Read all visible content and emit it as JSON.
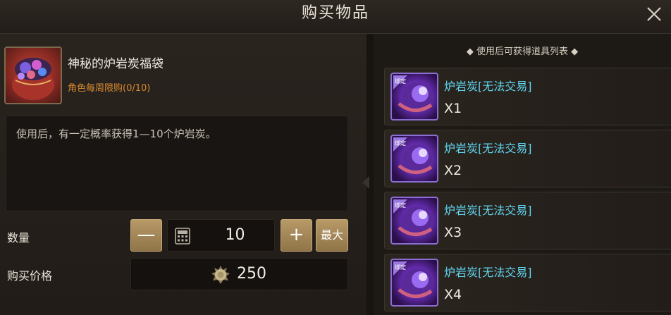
{
  "window": {
    "title": "购买物品"
  },
  "item": {
    "name": "神秘的炉岩炭福袋",
    "limit": "角色每周限购(0/10)",
    "icon": "lucky-bag-icon",
    "description": "使用后，有一定概率获得1—10个炉岩炭。"
  },
  "purchase": {
    "qty_label": "数量",
    "minus_label": "—",
    "plus_label": "+",
    "max_label": "最大",
    "quantity": "10",
    "price_label": "购买价格",
    "price": "250",
    "currency_icon": "gold-coin-icon"
  },
  "rewards": {
    "header": "◆ 使用后可获得道具列表 ◆",
    "items": [
      {
        "name": "炉岩炭[无法交易]",
        "qty": "X1",
        "badge": "绑定",
        "icon": "charcoal-orb-icon"
      },
      {
        "name": "炉岩炭[无法交易]",
        "qty": "X2",
        "badge": "绑定",
        "icon": "charcoal-orb-icon"
      },
      {
        "name": "炉岩炭[无法交易]",
        "qty": "X3",
        "badge": "绑定",
        "icon": "charcoal-orb-icon"
      },
      {
        "name": "炉岩炭[无法交易]",
        "qty": "X4",
        "badge": "绑定",
        "icon": "charcoal-orb-icon"
      }
    ]
  },
  "colors": {
    "accent_gold": "#b89968",
    "limit_orange": "#d88a2e",
    "reward_name_cyan": "#5fd6f0"
  }
}
